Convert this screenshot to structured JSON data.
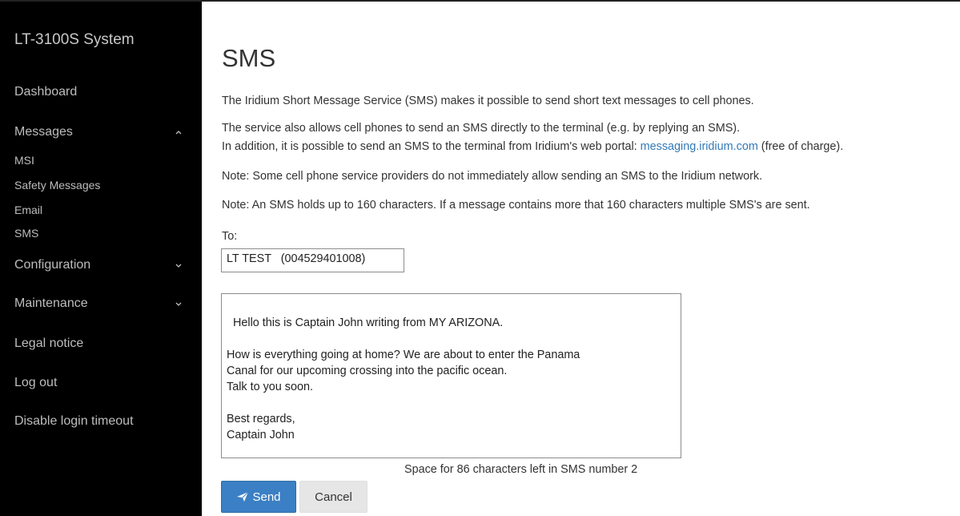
{
  "sidebar": {
    "brand": "LT-3100S System",
    "items": [
      {
        "label": "Dashboard"
      },
      {
        "label": "Messages",
        "icon": "chevron-up-icon"
      },
      {
        "label": "MSI"
      },
      {
        "label": "Safety Messages"
      },
      {
        "label": "Email"
      },
      {
        "label": "SMS"
      },
      {
        "label": "Configuration",
        "icon": "chevron-down-icon"
      },
      {
        "label": "Maintenance",
        "icon": "chevron-down-icon"
      },
      {
        "label": "Legal notice"
      },
      {
        "label": "Log out"
      },
      {
        "label": "Disable login timeout"
      }
    ]
  },
  "main": {
    "title": "SMS",
    "p1": "The Iridium Short Message Service (SMS) makes it possible to send short text messages to cell phones.",
    "p2_line1": "The service also allows cell phones to send an SMS directly to the terminal (e.g. by replying an SMS).",
    "p2_line2_pre": "In addition, it is possible to send an SMS to the terminal from Iridium's web portal: ",
    "p2_link": "messaging.iridium.com",
    "p2_line2_post": " (free of charge).",
    "note1": "Note: Some cell phone service providers do not immediately allow sending an SMS to the Iridium network.",
    "note2": "Note: An SMS holds up to 160 characters. If a message contains more that 160 characters multiple SMS's are sent.",
    "to_label": "To:",
    "to_value": "LT TEST   (004529401008)",
    "message": "Hello this is Captain John writing from MY ARIZONA.\n\nHow is everything going at home? We are about to enter the Panama\nCanal for our upcoming crossing into the pacific ocean.\nTalk to you soon.\n\nBest regards,\nCaptain John",
    "counter": "Space for 86 characters left in SMS number 2",
    "send_label": "Send",
    "cancel_label": "Cancel"
  },
  "colors": {
    "sidebar_bg": "#000000",
    "primary": "#3b7fc4",
    "link": "#337ab7"
  }
}
